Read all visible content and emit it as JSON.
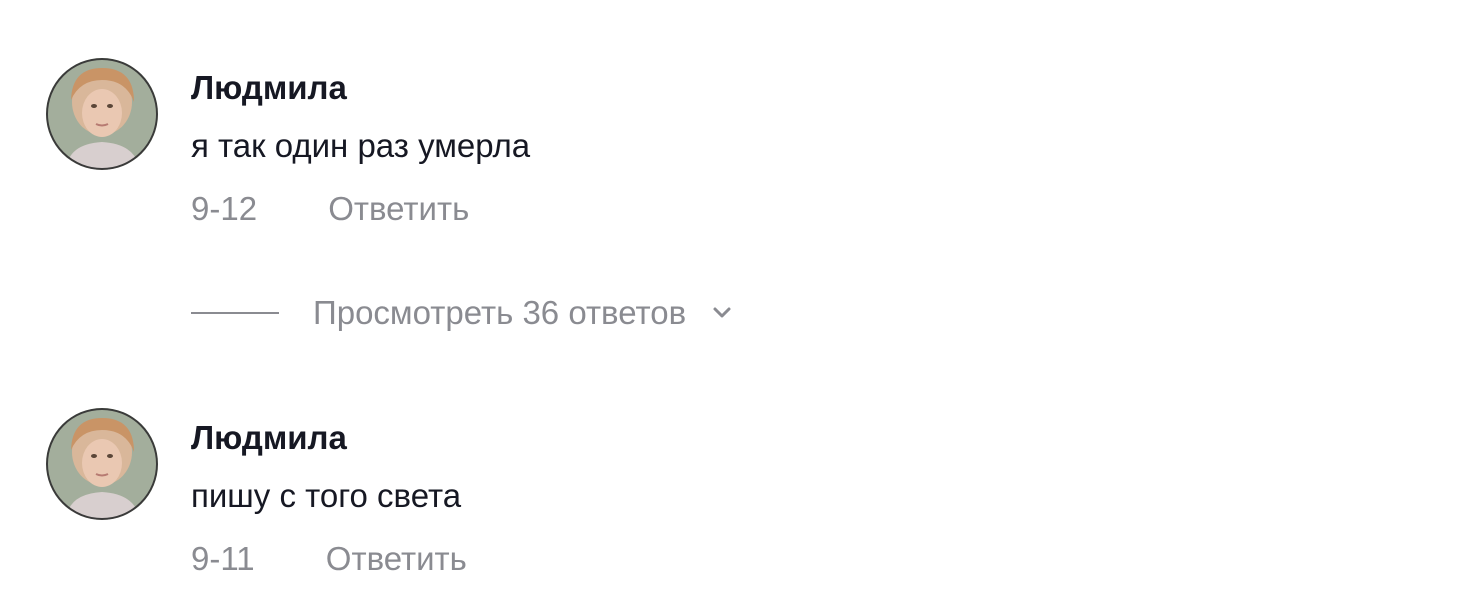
{
  "comments": [
    {
      "author": "Людмила",
      "text": "я так один раз умерла",
      "date": "9-12",
      "reply_label": "Ответить",
      "avatar_icon": "user-avatar-photo"
    },
    {
      "author": "Людмила",
      "text": "пишу с того света",
      "date": "9-11",
      "reply_label": "Ответить",
      "avatar_icon": "user-avatar-photo"
    }
  ],
  "view_replies": {
    "label": "Просмотреть 36 ответов",
    "icon": "chevron-down-icon"
  },
  "colors": {
    "text_primary": "#161823",
    "text_secondary": "#8a8b91",
    "background": "#ffffff"
  }
}
